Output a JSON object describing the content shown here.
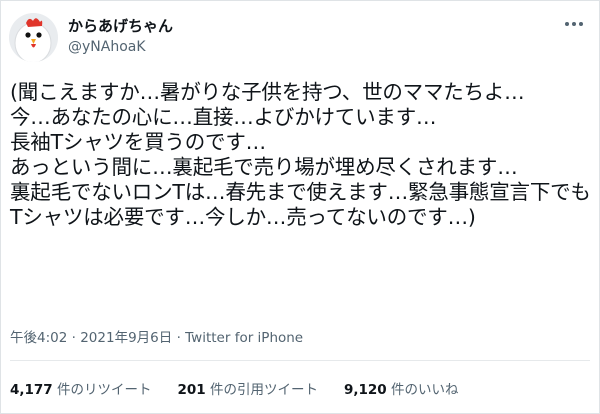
{
  "author": {
    "display_name": "からあげちゃん",
    "handle": "@yNAhoaK"
  },
  "tweet": {
    "text": "(聞こえますか…暑がりな子供を持つ、世のママたちよ…\n今…あなたの心に…直接…よびかけています…\n長袖Tシャツを買うのです…\nあっという間に…裏起毛で売り場が埋め尽くされます…\n裏起毛でないロンTは…春先まで使えます…緊急事態宣言下でもTシャツは必要です…今しか…売ってないのです…)"
  },
  "meta": {
    "time": "午後4:02",
    "date": "2021年9月6日",
    "separator": "·",
    "source": "Twitter for iPhone"
  },
  "stats": {
    "retweets_count": "4,177",
    "retweets_label": "件のリツイート",
    "quotes_count": "201",
    "quotes_label": "件の引用ツイート",
    "likes_count": "9,120",
    "likes_label": "件のいいね"
  },
  "icons": {
    "avatar": "chicken-avatar-icon",
    "more": "more-horizontal-icon"
  },
  "colors": {
    "text": "#0f1419",
    "secondary": "#536471",
    "divider": "#e6e9eb"
  }
}
